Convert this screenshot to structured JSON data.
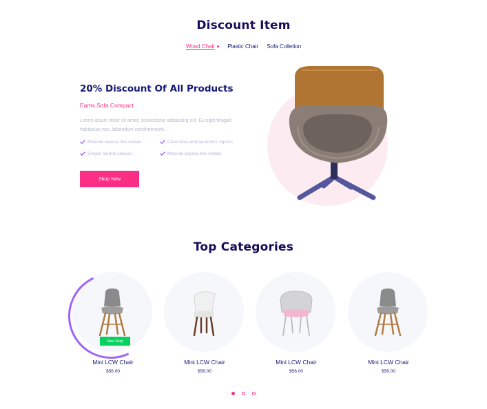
{
  "discount": {
    "title": "Discount Item",
    "tabs": [
      {
        "label": "Wood Chair",
        "active": true
      },
      {
        "label": "Plastic Chair",
        "active": false
      },
      {
        "label": "Sofa Colletion",
        "active": false
      }
    ],
    "heading": "20% Discount Of All Products",
    "subheading": "Eams Sofa Compact",
    "body": "Lorem ipsum dolor sit amet, consectetur adipiscing elit. Eu eget feugiat habitasse nec, bibendum condimentum.",
    "features": [
      "Material expose like metals",
      "Clear lines and geometric figures",
      "Simple neutral colours.",
      "Material expose like metals"
    ],
    "shop_button": "Shop Now",
    "colors": {
      "accent": "#fb2e86",
      "navy": "#151875",
      "hero_bg": "#fcecf1"
    }
  },
  "categories": {
    "title": "Top Categories",
    "items": [
      {
        "name": "Mini LCW Chair",
        "price": "$56.00",
        "active": true,
        "view_label": "View Shop"
      },
      {
        "name": "Mini LCW Chair",
        "price": "$56.00",
        "active": false
      },
      {
        "name": "Mini LCW Chair",
        "price": "$56.00",
        "active": false
      },
      {
        "name": "Mini LCW Chair",
        "price": "$56.00",
        "active": false
      }
    ],
    "pagination": {
      "count": 3,
      "active_index": 0
    },
    "colors": {
      "view_button": "#08d15f",
      "ring": "#9f63f5"
    }
  }
}
